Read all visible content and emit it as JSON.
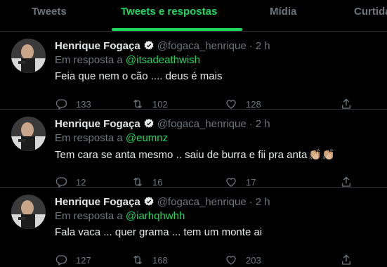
{
  "tabs": [
    {
      "label": "Tweets"
    },
    {
      "label": "Tweets e respostas"
    },
    {
      "label": "Mídia"
    },
    {
      "label": "Curtidas"
    }
  ],
  "colors": {
    "accent": "#1ed760",
    "muted": "#6e767d",
    "divider": "#2f3336"
  },
  "tweets": [
    {
      "name": "Henrique Fogaça",
      "handle": "@fogaca_henrique",
      "dot": "·",
      "time": "2 h",
      "reply_prefix": "Em resposta a",
      "reply_to": "@itsadeathwish",
      "text": "Feia que nem o cão .... deus é mais",
      "replies": "133",
      "retweets": "102",
      "likes": "128"
    },
    {
      "name": "Henrique Fogaça",
      "handle": "@fogaca_henrique",
      "dot": "·",
      "time": "2 h",
      "reply_prefix": "Em resposta a",
      "reply_to": "@eumnz",
      "text": "Tem cara se anta mesmo .. saiu de burra e fii pra anta",
      "emoji": "👏🏼👏🏼",
      "replies": "12",
      "retweets": "16",
      "likes": "17"
    },
    {
      "name": "Henrique Fogaça",
      "handle": "@fogaca_henrique",
      "dot": "·",
      "time": "2 h",
      "reply_prefix": "Em resposta a",
      "reply_to": "@iarhqhwhh",
      "text": "Fala vaca ... quer grama ... tem um monte ai",
      "replies": "127",
      "retweets": "168",
      "likes": "203"
    }
  ]
}
